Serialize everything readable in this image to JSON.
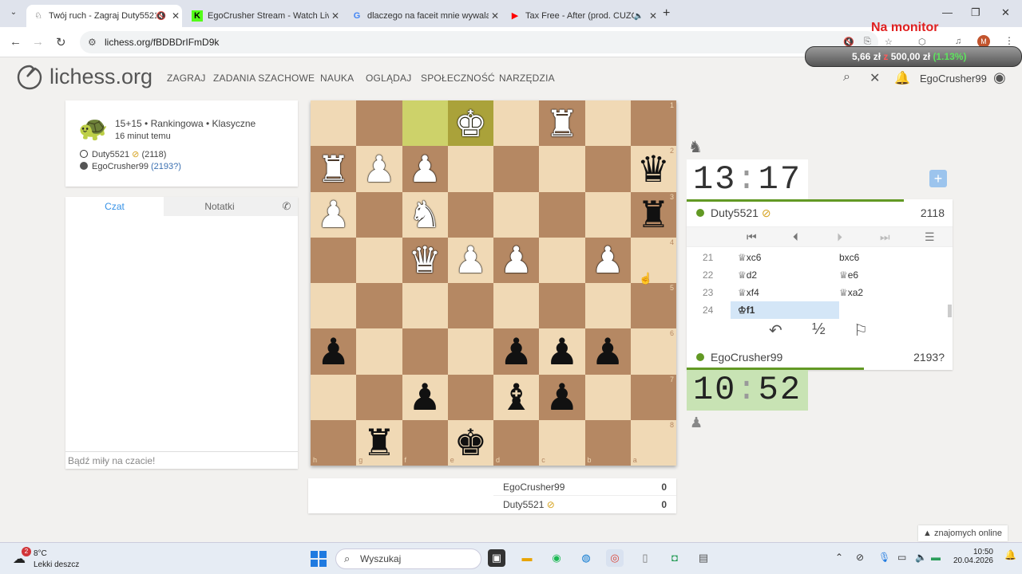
{
  "browser": {
    "tabs": [
      {
        "title": "Twój ruch - Zagraj Duty5521",
        "icon": "lichess-icon",
        "muted": true,
        "active": true
      },
      {
        "title": "EgoCrusher Stream - Watch Live",
        "icon": "kick-icon",
        "muted": false,
        "active": false
      },
      {
        "title": "dlaczego na faceit mnie wywala",
        "icon": "google-icon",
        "muted": false,
        "active": false
      },
      {
        "title": "Tax Free - After (prod. CUZO)",
        "icon": "youtube-icon",
        "muted": true,
        "active": false
      }
    ],
    "url": "lichess.org/fBDBDrIFmD9k"
  },
  "overlay": {
    "title": "Na monitor",
    "amount": "5,66 zł",
    "of_word": "z",
    "goal": "500,00 zł",
    "percent": "(1.13%)"
  },
  "lichess": {
    "logo_text": "lichess.org",
    "nav": [
      "ZAGRAJ",
      "ZADANIA SZACHOWE",
      "NAUKA",
      "OGLĄDAJ",
      "SPOŁECZNOŚĆ",
      "NARZĘDZIA"
    ],
    "username": "EgoCrusher99"
  },
  "game": {
    "type": "15+15 • Rankingowa • Klasyczne",
    "time_ago": "16 minut temu",
    "white": {
      "name": "Duty5521",
      "rating": "(2118)"
    },
    "black": {
      "name": "EgoCrusher99",
      "rating": "(2193?)"
    }
  },
  "chat": {
    "tab_chat": "Czat",
    "tab_notes": "Notatki",
    "placeholder": "Bądź miły na czacie!"
  },
  "board": {
    "orientation": "black",
    "rows": [
      [
        "",
        "",
        "",
        "wK",
        "",
        "wR",
        "",
        ""
      ],
      [
        "wR",
        "wP",
        "wP",
        "",
        "",
        "",
        "",
        "bQ"
      ],
      [
        "wP",
        "",
        "wN",
        "",
        "",
        "",
        "",
        "bR"
      ],
      [
        "",
        "",
        "wQ",
        "wP",
        "wP",
        "",
        "wP",
        ""
      ],
      [
        "",
        "",
        "",
        "",
        "",
        "",
        "",
        ""
      ],
      [
        "bP",
        "",
        "",
        "",
        "bP",
        "bP",
        "bP",
        ""
      ],
      [
        "",
        "",
        "bP",
        "",
        "bB",
        "bP",
        "",
        ""
      ],
      [
        "",
        "bR",
        "",
        "bK",
        "",
        "",
        "",
        ""
      ]
    ],
    "ranks": [
      "1",
      "2",
      "3",
      "4",
      "5",
      "6",
      "7",
      "8"
    ],
    "files": [
      "h",
      "g",
      "f",
      "e",
      "d",
      "c",
      "b",
      "a"
    ],
    "last_move": [
      "h1e1",
      "g1f1"
    ],
    "highlight": {
      "from": "f1",
      "to": "e1"
    }
  },
  "score": {
    "rows": [
      {
        "name": "EgoCrusher99",
        "score": "0"
      },
      {
        "name": "Duty5521",
        "score": "0"
      }
    ]
  },
  "clocks": {
    "top": {
      "min": "13",
      "sec": "17"
    },
    "bottom": {
      "min": "10",
      "sec": "52"
    }
  },
  "players": {
    "top": {
      "name": "Duty5521",
      "rating": "2118"
    },
    "bottom": {
      "name": "EgoCrusher99",
      "rating": "2193?"
    }
  },
  "moves": [
    {
      "no": "21",
      "white": "♕xc6",
      "black": "bxc6"
    },
    {
      "no": "22",
      "white": "♕d2",
      "black": "♕e6"
    },
    {
      "no": "23",
      "white": "♕xf4",
      "black": "♕xa2"
    },
    {
      "no": "24",
      "white": "♔f1",
      "black": ""
    }
  ],
  "actions": {
    "draw": "½"
  },
  "online": "znajomych online",
  "taskbar": {
    "temp": "8°C",
    "cond": "Lekki deszcz",
    "badge": "2",
    "search": "Wyszukaj",
    "time": "10:50",
    "date": "20.04.2026"
  }
}
